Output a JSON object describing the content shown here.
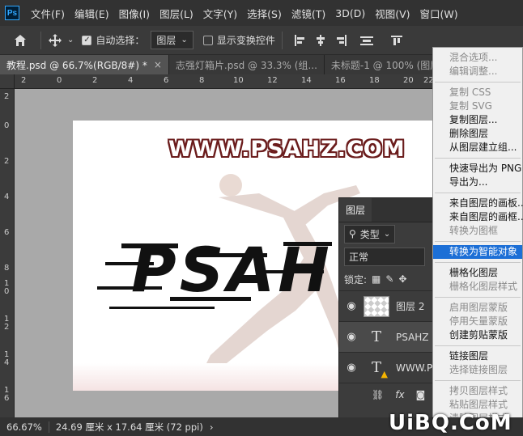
{
  "app": {
    "logo": "Ps"
  },
  "menubar": {
    "items": [
      "文件(F)",
      "编辑(E)",
      "图像(I)",
      "图层(L)",
      "文字(Y)",
      "选择(S)",
      "滤镜(T)",
      "3D(D)",
      "视图(V)",
      "窗口(W)"
    ]
  },
  "optionsbar": {
    "auto_select_label": "自动选择：",
    "auto_select_value": "图层",
    "show_transform_label": "显示变换控件"
  },
  "tabs": [
    {
      "label": "教程.psd @ 66.7%(RGB/8#) *",
      "close": "×"
    },
    {
      "label": "志强灯箱片.psd @ 33.3% (组...",
      "close": ""
    },
    {
      "label": "未标题-1 @ 100% (图层...",
      "close": ""
    }
  ],
  "rulers": {
    "top": [
      "2",
      "0",
      "2",
      "4",
      "6",
      "8",
      "10",
      "12",
      "14",
      "16",
      "18",
      "20",
      "22"
    ],
    "left": [
      "2",
      "0",
      "2",
      "4",
      "6",
      "8",
      "1 0",
      "1 2",
      "1 4",
      "1 6"
    ]
  },
  "canvas": {
    "site_text": "WWW.PSAHZ.COM",
    "big_text": "PSAH"
  },
  "layers_panel": {
    "title": "图层",
    "filter_label": "类型",
    "blend_mode": "正常",
    "lock_label": "锁定:",
    "layers": [
      {
        "name": "图层 2",
        "kind": "raster"
      },
      {
        "name": "PSAHZ",
        "kind": "text"
      },
      {
        "name": "WWW.P",
        "kind": "text-warning"
      }
    ],
    "footer_fx": "fx"
  },
  "context_menu": {
    "groups": [
      [
        {
          "label": "混合选项...",
          "enabled": false
        },
        {
          "label": "编辑调整...",
          "enabled": false
        }
      ],
      [
        {
          "label": "复制 CSS",
          "enabled": false
        },
        {
          "label": "复制 SVG",
          "enabled": false
        },
        {
          "label": "复制图层...",
          "enabled": true
        },
        {
          "label": "删除图层",
          "enabled": true
        },
        {
          "label": "从图层建立组...",
          "enabled": true
        }
      ],
      [
        {
          "label": "快速导出为 PNG",
          "enabled": true
        },
        {
          "label": "导出为...",
          "enabled": true
        }
      ],
      [
        {
          "label": "来自图层的画板...",
          "enabled": true
        },
        {
          "label": "来自图层的画框...",
          "enabled": true
        },
        {
          "label": "转换为图框",
          "enabled": false
        }
      ],
      [
        {
          "label": "转换为智能对象",
          "enabled": true,
          "highlighted": true
        }
      ],
      [
        {
          "label": "栅格化图层",
          "enabled": true
        },
        {
          "label": "栅格化图层样式",
          "enabled": false
        }
      ],
      [
        {
          "label": "启用图层蒙版",
          "enabled": false
        },
        {
          "label": "停用矢量蒙版",
          "enabled": false
        },
        {
          "label": "创建剪贴蒙版",
          "enabled": true
        }
      ],
      [
        {
          "label": "链接图层",
          "enabled": true
        },
        {
          "label": "选择链接图层",
          "enabled": false
        }
      ],
      [
        {
          "label": "拷贝图层样式",
          "enabled": false
        },
        {
          "label": "粘贴图层样式",
          "enabled": false
        },
        {
          "label": "清除图层样式",
          "enabled": false
        }
      ]
    ]
  },
  "statusbar": {
    "zoom": "66.67%",
    "doc_size": "24.69 厘米 x 17.64 厘米 (72 ppi)"
  },
  "watermark": {
    "text": "UiBQ.CoM"
  },
  "colors": {
    "highlight": "#1c6fd6",
    "site_text_stroke": "#6b1c1c",
    "warning": "#f5b400"
  }
}
